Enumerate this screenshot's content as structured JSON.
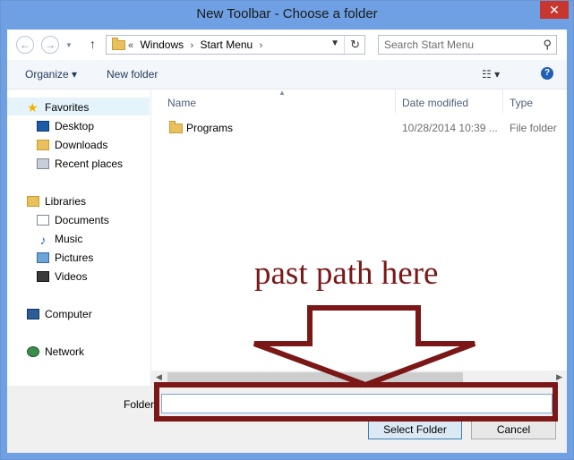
{
  "window": {
    "title": "New Toolbar - Choose a folder",
    "close_glyph": "✕"
  },
  "address": {
    "prefix": "«",
    "crumbs": [
      "Windows",
      "Start Menu"
    ],
    "separator": "›"
  },
  "search": {
    "placeholder": "Search Start Menu"
  },
  "toolbar": {
    "organize_label": "Organize ▾",
    "new_folder_label": "New folder"
  },
  "nav": {
    "favorites": "Favorites",
    "desktop": "Desktop",
    "downloads": "Downloads",
    "recent": "Recent places",
    "libraries": "Libraries",
    "documents": "Documents",
    "music": "Music",
    "pictures": "Pictures",
    "videos": "Videos",
    "computer": "Computer",
    "network": "Network"
  },
  "columns": {
    "name": "Name",
    "date": "Date modified",
    "type": "Type"
  },
  "rows": [
    {
      "name": "Programs",
      "date": "10/28/2014 10:39 ...",
      "type": "File folder"
    }
  ],
  "bottom": {
    "folder_label": "Folder:",
    "folder_value": "",
    "select_label": "Select Folder",
    "cancel_label": "Cancel"
  },
  "annotation": {
    "text": "past path here",
    "color": "#7b1717"
  },
  "colors": {
    "titlebar": "#6ea0e3",
    "selection": "#e5f3fb",
    "close": "#c7372f"
  }
}
